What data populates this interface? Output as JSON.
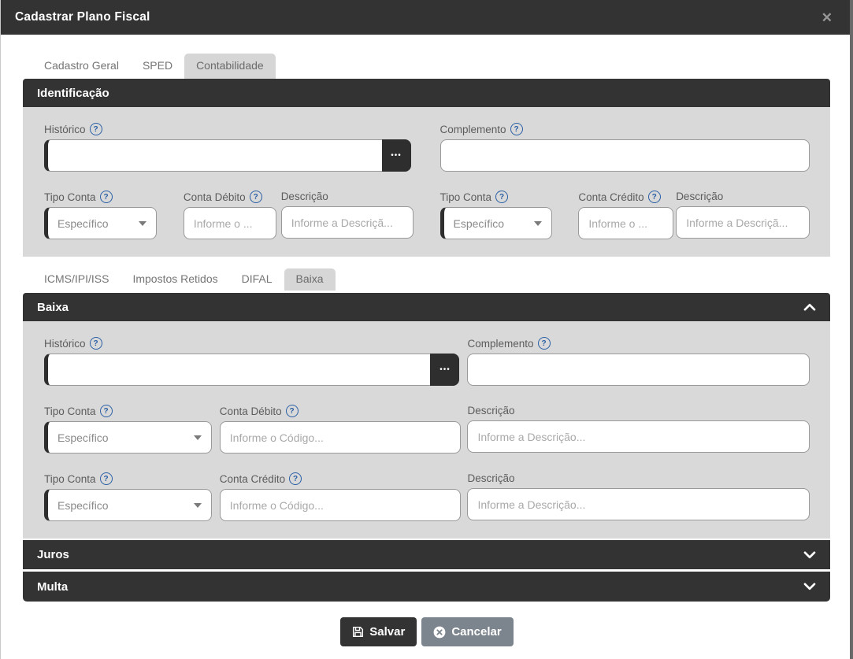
{
  "modal": {
    "title": "Cadastrar Plano Fiscal"
  },
  "icons": {
    "close": "✕",
    "help": "?",
    "more": "•••"
  },
  "main_tabs": [
    {
      "label": "Cadastro Geral",
      "active": false
    },
    {
      "label": "SPED",
      "active": false
    },
    {
      "label": "Contabilidade",
      "active": true
    }
  ],
  "identificacao": {
    "title": "Identificação",
    "historico": {
      "label": "Histórico",
      "value": ""
    },
    "complemento": {
      "label": "Complemento",
      "value": ""
    },
    "tipo_conta_debito": {
      "label": "Tipo Conta",
      "value": "Específico"
    },
    "conta_debito": {
      "label": "Conta Débito",
      "placeholder": "Informe o ..."
    },
    "descricao_debito": {
      "label": "Descrição",
      "placeholder": "Informe a Descriçã..."
    },
    "tipo_conta_credito": {
      "label": "Tipo Conta",
      "value": "Específico"
    },
    "conta_credito": {
      "label": "Conta Crédito",
      "placeholder": "Informe o ..."
    },
    "descricao_credito": {
      "label": "Descrição",
      "placeholder": "Informe a Descriçã..."
    }
  },
  "sub_tabs": [
    {
      "label": "ICMS/IPI/ISS",
      "active": false
    },
    {
      "label": "Impostos Retidos",
      "active": false
    },
    {
      "label": "DIFAL",
      "active": false
    },
    {
      "label": "Baixa",
      "active": true
    }
  ],
  "baixa": {
    "title": "Baixa",
    "historico": {
      "label": "Histórico",
      "value": ""
    },
    "complemento": {
      "label": "Complemento",
      "value": ""
    },
    "tipo_conta_debito": {
      "label": "Tipo Conta",
      "value": "Específico"
    },
    "conta_debito": {
      "label": "Conta Débito",
      "placeholder": "Informe o Código..."
    },
    "descricao_debito": {
      "label": "Descrição",
      "placeholder": "Informe a Descrição..."
    },
    "tipo_conta_credito": {
      "label": "Tipo Conta",
      "value": "Específico"
    },
    "conta_credito": {
      "label": "Conta Crédito",
      "placeholder": "Informe o Código..."
    },
    "descricao_credito": {
      "label": "Descrição",
      "placeholder": "Informe a Descrição..."
    }
  },
  "accordions": [
    {
      "label": "Juros",
      "expanded": false
    },
    {
      "label": "Multa",
      "expanded": false
    }
  ],
  "footer": {
    "save_label": "Salvar",
    "cancel_label": "Cancelar"
  },
  "colors": {
    "dark": "#333333",
    "section_bg": "#d9d9d9",
    "help_blue": "#2a5fa5",
    "cancel_bg": "#7c858d"
  }
}
